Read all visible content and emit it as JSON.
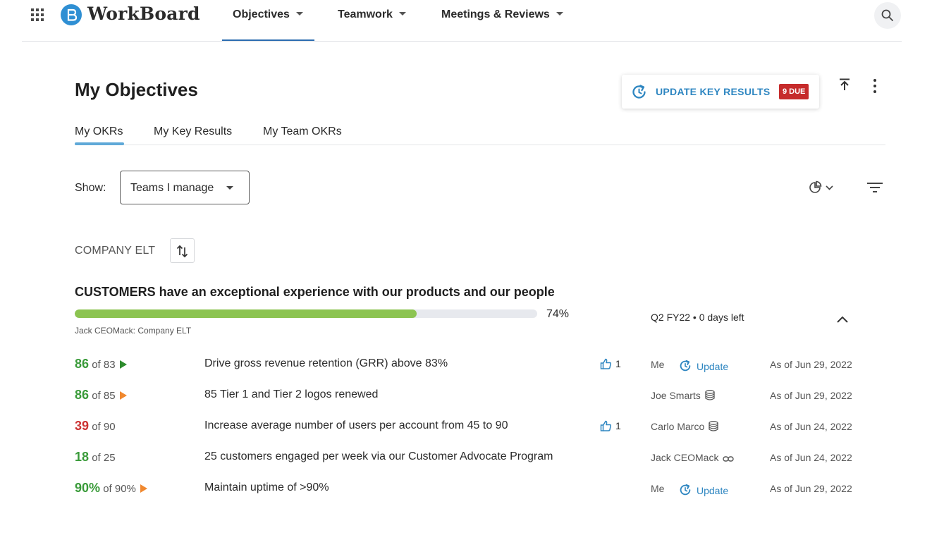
{
  "nav": {
    "brand": "WorkBoard",
    "tabs": [
      {
        "label": "Objectives"
      },
      {
        "label": "Teamwork"
      },
      {
        "label": "Meetings & Reviews"
      }
    ]
  },
  "header": {
    "title": "My Objectives",
    "update_button": {
      "label": "UPDATE KEY RESULTS",
      "badge": "9 DUE"
    }
  },
  "subtabs": [
    {
      "label": "My OKRs"
    },
    {
      "label": "My Key Results"
    },
    {
      "label": "My Team OKRs"
    }
  ],
  "filter": {
    "show_label": "Show:",
    "selected": "Teams I manage"
  },
  "group": {
    "title": "COMPANY ELT"
  },
  "objective": {
    "title": "CUSTOMERS have an exceptional experience with our products and our people",
    "progress_pct": 74,
    "progress_label": "74%",
    "owner": "Jack CEOMack: Company ELT",
    "period": "Q2 FY22 • 0  days left"
  },
  "key_results": [
    {
      "score": "86",
      "target": " of 83",
      "score_color": "#3a9b3a",
      "flag_color": "#2e8b2e",
      "title": "Drive gross revenue retention (GRR) above 83%",
      "likes": "1",
      "owner": "Me",
      "update_label": "Update",
      "as_of": "As of Jun 29, 2022"
    },
    {
      "score": "86",
      "target": " of 85",
      "score_color": "#3a9b3a",
      "flag_color": "#f0882f",
      "title": "85 Tier 1 and Tier 2 logos renewed",
      "likes": "",
      "owner": "Joe Smarts",
      "owner_icon": "database-icon",
      "update_label": "",
      "as_of": "As of Jun 29, 2022"
    },
    {
      "score": "39",
      "target": " of 90",
      "score_color": "#cc3333",
      "flag_color": "",
      "title": "Increase average number of users per account from 45 to 90",
      "likes": "1",
      "owner": "Carlo Marco",
      "owner_icon": "database-icon",
      "update_label": "",
      "as_of": "As of Jun 24, 2022"
    },
    {
      "score": "18",
      "target": " of 25",
      "score_color": "#3a9b3a",
      "flag_color": "",
      "title": "25 customers engaged per week via our Customer Advocate Program",
      "likes": "",
      "owner": "Jack CEOMack",
      "owner_icon": "link-icon",
      "update_label": "",
      "as_of": "As of Jun 24, 2022"
    },
    {
      "score": "90%",
      "target": " of 90%",
      "score_color": "#3a9b3a",
      "flag_color": "#f0882f",
      "title": "Maintain uptime of >90%",
      "likes": "",
      "owner": "Me",
      "update_label": "Update",
      "as_of": "As of Jun 29, 2022"
    }
  ]
}
